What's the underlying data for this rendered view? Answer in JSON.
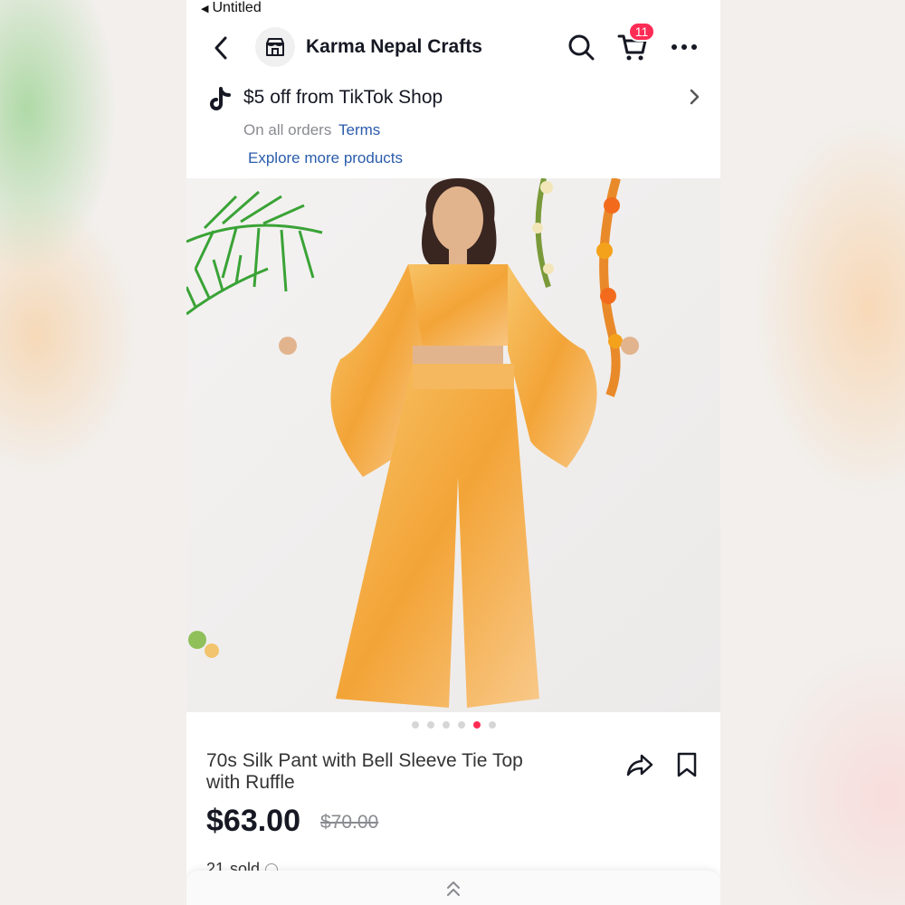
{
  "status_bar": {
    "back_app_label": "Untitled"
  },
  "header": {
    "shop_name": "Karma Nepal Crafts",
    "cart_count": "11",
    "icons": [
      "back-arrow-icon",
      "shop-icon",
      "search-icon",
      "cart-icon",
      "more-icon"
    ]
  },
  "promo": {
    "title": "$5 off from TikTok Shop",
    "subtitle": "On all orders",
    "terms_label": "Terms",
    "explore_label": "Explore more products"
  },
  "gallery": {
    "image_count": 6,
    "active_index": 4
  },
  "product": {
    "title": "70s Silk Pant with Bell Sleeve Tie Top\nwith Ruffle",
    "price": "$63.00",
    "original_price": "$70.00",
    "sold": "21",
    "sold_suffix": "sold"
  },
  "colors": {
    "accent": "#fe2c55",
    "link": "#2b5cab",
    "outfit": "#f3a437"
  }
}
